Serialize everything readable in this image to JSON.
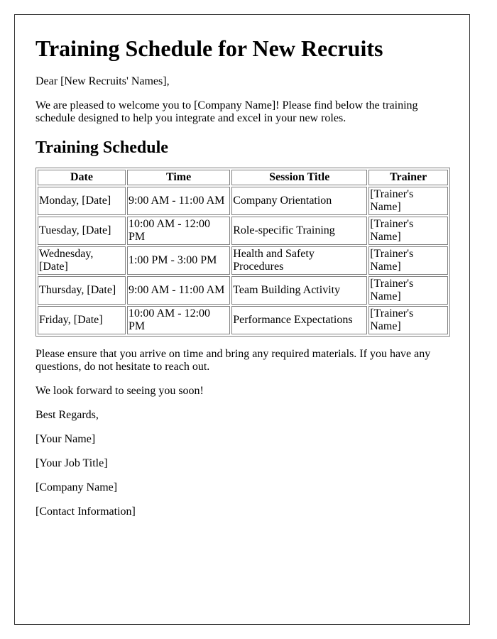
{
  "letter": {
    "title": "Training Schedule for New Recruits",
    "greeting": "Dear [New Recruits' Names],",
    "intro": "We are pleased to welcome you to [Company Name]! Please find below the training schedule designed to help you integrate and excel in your new roles.",
    "schedule_heading": "Training Schedule",
    "table": {
      "headers": [
        "Date",
        "Time",
        "Session Title",
        "Trainer"
      ],
      "rows": [
        [
          "Monday, [Date]",
          "9:00 AM - 11:00 AM",
          "Company Orientation",
          "[Trainer's Name]"
        ],
        [
          "Tuesday, [Date]",
          "10:00 AM - 12:00 PM",
          "Role-specific Training",
          "[Trainer's Name]"
        ],
        [
          "Wednesday, [Date]",
          "1:00 PM - 3:00 PM",
          "Health and Safety Procedures",
          "[Trainer's Name]"
        ],
        [
          "Thursday, [Date]",
          "9:00 AM - 11:00 AM",
          "Team Building Activity",
          "[Trainer's Name]"
        ],
        [
          "Friday, [Date]",
          "10:00 AM - 12:00 PM",
          "Performance Expectations",
          "[Trainer's Name]"
        ]
      ]
    },
    "reminder": "Please ensure that you arrive on time and bring any required materials. If you have any questions, do not hesitate to reach out.",
    "closing_line": "We look forward to seeing you soon!",
    "sign_off": "Best Regards,",
    "signature": {
      "name": "[Your Name]",
      "job_title": "[Your Job Title]",
      "company": "[Company Name]",
      "contact": "[Contact Information]"
    }
  }
}
